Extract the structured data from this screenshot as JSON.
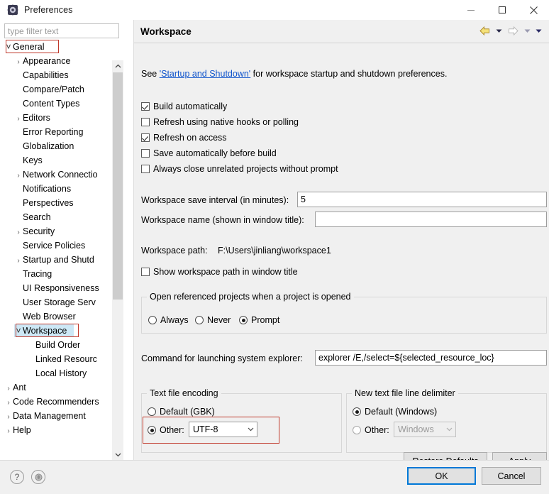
{
  "window": {
    "title": "Preferences",
    "icon": "preferences-icon",
    "controls": {
      "minimize": "minimize-icon",
      "maximize": "maximize-icon",
      "close": "close-icon"
    }
  },
  "filter": {
    "placeholder": "type filter text",
    "value": ""
  },
  "tree": {
    "items": [
      {
        "label": "General",
        "indent": 0,
        "arrow": "down",
        "selected": false,
        "annotated": true
      },
      {
        "label": "Appearance",
        "indent": 1,
        "arrow": "right",
        "selected": false,
        "annotated": false
      },
      {
        "label": "Capabilities",
        "indent": 1,
        "arrow": "none",
        "selected": false,
        "annotated": false
      },
      {
        "label": "Compare/Patch",
        "indent": 1,
        "arrow": "none",
        "selected": false,
        "annotated": false
      },
      {
        "label": "Content Types",
        "indent": 1,
        "arrow": "none",
        "selected": false,
        "annotated": false
      },
      {
        "label": "Editors",
        "indent": 1,
        "arrow": "right",
        "selected": false,
        "annotated": false
      },
      {
        "label": "Error Reporting",
        "indent": 1,
        "arrow": "none",
        "selected": false,
        "annotated": false
      },
      {
        "label": "Globalization",
        "indent": 1,
        "arrow": "none",
        "selected": false,
        "annotated": false
      },
      {
        "label": "Keys",
        "indent": 1,
        "arrow": "none",
        "selected": false,
        "annotated": false
      },
      {
        "label": "Network Connectio",
        "indent": 1,
        "arrow": "right",
        "selected": false,
        "annotated": false
      },
      {
        "label": "Notifications",
        "indent": 1,
        "arrow": "none",
        "selected": false,
        "annotated": false
      },
      {
        "label": "Perspectives",
        "indent": 1,
        "arrow": "none",
        "selected": false,
        "annotated": false
      },
      {
        "label": "Search",
        "indent": 1,
        "arrow": "none",
        "selected": false,
        "annotated": false
      },
      {
        "label": "Security",
        "indent": 1,
        "arrow": "right",
        "selected": false,
        "annotated": false
      },
      {
        "label": "Service Policies",
        "indent": 1,
        "arrow": "none",
        "selected": false,
        "annotated": false
      },
      {
        "label": "Startup and Shutd",
        "indent": 1,
        "arrow": "right",
        "selected": false,
        "annotated": false
      },
      {
        "label": "Tracing",
        "indent": 1,
        "arrow": "none",
        "selected": false,
        "annotated": false
      },
      {
        "label": "UI Responsiveness",
        "indent": 1,
        "arrow": "none",
        "selected": false,
        "annotated": false
      },
      {
        "label": "User Storage Serv",
        "indent": 1,
        "arrow": "none",
        "selected": false,
        "annotated": false
      },
      {
        "label": "Web Browser",
        "indent": 1,
        "arrow": "none",
        "selected": false,
        "annotated": false
      },
      {
        "label": "Workspace",
        "indent": 1,
        "arrow": "down",
        "selected": true,
        "annotated": true
      },
      {
        "label": "Build Order",
        "indent": 2,
        "arrow": "none",
        "selected": false,
        "annotated": false
      },
      {
        "label": "Linked Resourc",
        "indent": 2,
        "arrow": "none",
        "selected": false,
        "annotated": false
      },
      {
        "label": "Local History",
        "indent": 2,
        "arrow": "none",
        "selected": false,
        "annotated": false
      },
      {
        "label": "Ant",
        "indent": 0,
        "arrow": "right",
        "selected": false,
        "annotated": false
      },
      {
        "label": "Code Recommenders",
        "indent": 0,
        "arrow": "right",
        "selected": false,
        "annotated": false
      },
      {
        "label": "Data Management",
        "indent": 0,
        "arrow": "right",
        "selected": false,
        "annotated": false
      },
      {
        "label": "Help",
        "indent": 0,
        "arrow": "right",
        "selected": false,
        "annotated": false
      }
    ],
    "scroll_up_icon": "chevron-up-icon",
    "scroll_down_icon": "chevron-down-icon",
    "scroll_left_icon": "chevron-left-icon",
    "scroll_right_icon": "chevron-right-icon"
  },
  "page": {
    "title": "Workspace",
    "nav": {
      "back_icon": "back-arrow-icon",
      "back_menu_icon": "chevron-down-icon",
      "forward_icon": "forward-arrow-icon",
      "forward_menu_icon": "chevron-down-icon",
      "overflow_menu_icon": "chevron-down-icon"
    },
    "intro": {
      "prefix": "See ",
      "link": "'Startup and Shutdown'",
      "suffix": " for workspace startup and shutdown preferences."
    },
    "checkboxes": [
      {
        "label": "Build automatically",
        "checked": true
      },
      {
        "label": "Refresh using native hooks or polling",
        "checked": false
      },
      {
        "label": "Refresh on access",
        "checked": true
      },
      {
        "label": "Save automatically before build",
        "checked": false
      },
      {
        "label": "Always close unrelated projects without prompt",
        "checked": false
      }
    ],
    "save_interval": {
      "label": "Workspace save interval (in minutes):",
      "value": "5"
    },
    "workspace_name": {
      "label": "Workspace name (shown in window title):",
      "value": ""
    },
    "workspace_path": {
      "label": "Workspace path:",
      "value": "F:\\Users\\jinliang\\workspace1"
    },
    "show_path_checkbox": {
      "label": "Show workspace path in window title",
      "checked": false
    },
    "open_referenced": {
      "group_label": "Open referenced projects when a project is opened",
      "options": [
        {
          "label": "Always",
          "selected": false
        },
        {
          "label": "Never",
          "selected": false
        },
        {
          "label": "Prompt",
          "selected": true
        }
      ]
    },
    "explorer_command": {
      "label": "Command for launching system explorer:",
      "value": "explorer /E,/select=${selected_resource_loc}"
    },
    "text_file_encoding": {
      "group_label": "Text file encoding",
      "default_option": {
        "label": "Default (GBK)",
        "selected": false
      },
      "other_option": {
        "label": "Other:",
        "selected": true
      },
      "combo_value": "UTF-8",
      "combo_arrow_icon": "chevron-down-icon",
      "annotated": true
    },
    "line_delimiter": {
      "group_label": "New text file line delimiter",
      "default_option": {
        "label": "Default (Windows)",
        "selected": true
      },
      "other_option": {
        "label": "Other:",
        "selected": false
      },
      "combo_value": "Windows",
      "combo_disabled": true,
      "combo_arrow_icon": "chevron-down-icon"
    },
    "restore_defaults_label": "Restore Defaults",
    "apply_label": "Apply"
  },
  "footer": {
    "help_icon": "help-question-icon",
    "secondary_icon": "info-circle-icon",
    "ok_label": "OK",
    "cancel_label": "Cancel"
  },
  "colors": {
    "accent": "#0078d7",
    "selection": "#cde8f6",
    "annotation": "#c0392b",
    "link": "#1155cc",
    "panel_bg": "#f0f0f0"
  }
}
